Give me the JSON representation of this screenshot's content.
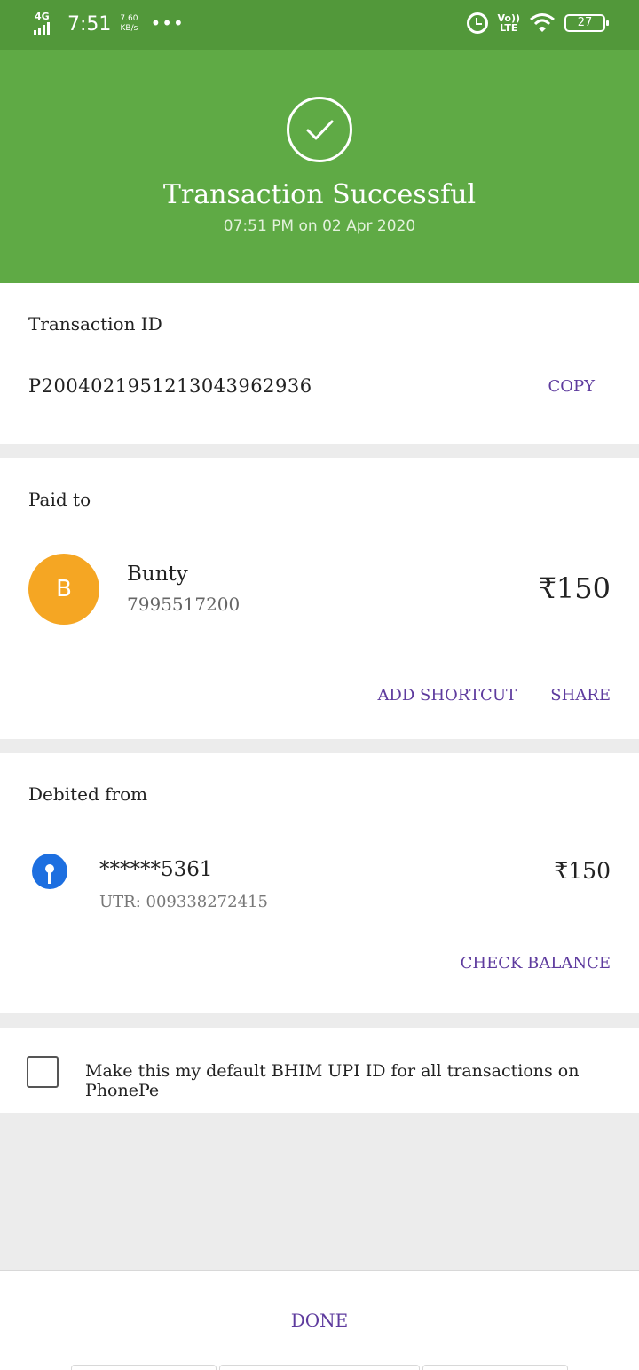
{
  "status_bar": {
    "network": "4G",
    "time": "7:51",
    "speed_value": "7.60",
    "speed_unit": "KB/s",
    "more": "•••",
    "volte_top": "Vo))",
    "volte_bottom": "LTE",
    "battery": "27"
  },
  "header": {
    "title": "Transaction Successful",
    "subtitle": "07:51 PM on 02 Apr 2020"
  },
  "transaction": {
    "label": "Transaction ID",
    "id": "P2004021951213043962936",
    "copy_label": "COPY"
  },
  "paid_to": {
    "label": "Paid to",
    "avatar_initial": "B",
    "name": "Bunty",
    "phone": "7995517200",
    "amount": "₹150",
    "add_shortcut_label": "ADD SHORTCUT",
    "share_label": "SHARE"
  },
  "debited_from": {
    "label": "Debited from",
    "account": "******5361",
    "utr": "UTR: 009338272415",
    "amount": "₹150",
    "check_balance_label": "CHECK BALANCE"
  },
  "default_upi": {
    "text": "Make this my default BHIM UPI ID for all transactions on PhonePe",
    "checked": false
  },
  "footer": {
    "done_label": "DONE"
  },
  "colors": {
    "status_bar": "#52983a",
    "header": "#5faa45",
    "link": "#5e3b9e",
    "avatar": "#f5a623",
    "bank_logo": "#1d6fe0"
  }
}
